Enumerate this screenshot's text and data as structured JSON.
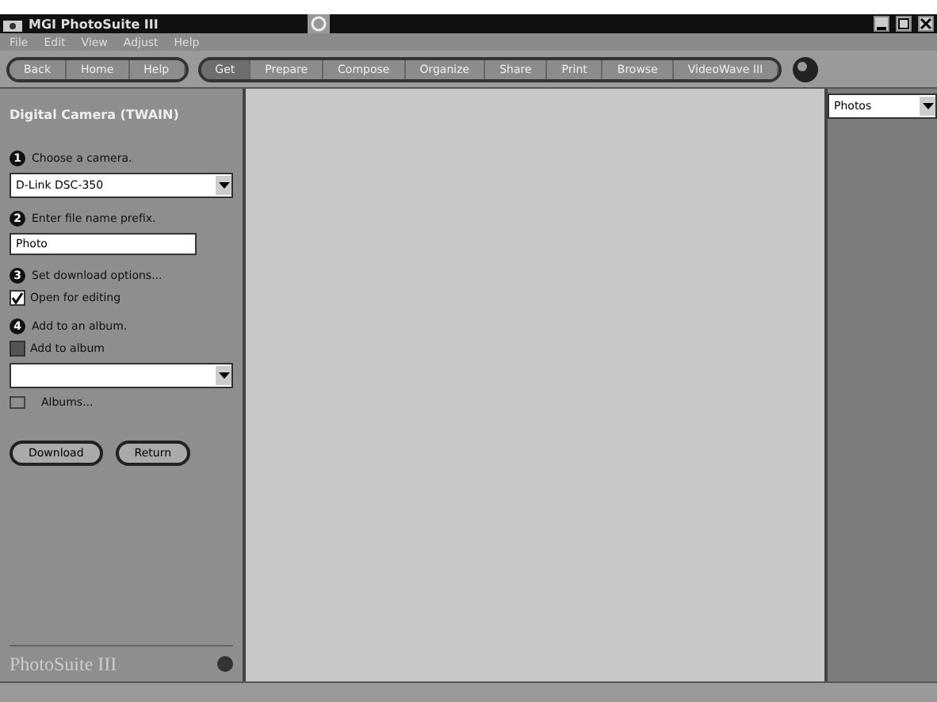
{
  "window": {
    "title": "MGI PhotoSuite III"
  },
  "menu": [
    "File",
    "Edit",
    "View",
    "Adjust",
    "Help"
  ],
  "nav_buttons": [
    "Back",
    "Home",
    "Help"
  ],
  "activity_tabs": [
    {
      "label": "Get",
      "selected": true
    },
    {
      "label": "Prepare",
      "selected": false
    },
    {
      "label": "Compose",
      "selected": false
    },
    {
      "label": "Organize",
      "selected": false
    },
    {
      "label": "Share",
      "selected": false
    },
    {
      "label": "Print",
      "selected": false
    },
    {
      "label": "Browse",
      "selected": false
    },
    {
      "label": "VideoWave III",
      "selected": false
    }
  ],
  "panel": {
    "title": "Digital Camera (TWAIN)",
    "steps": [
      {
        "number": "1",
        "label": "Choose a camera.",
        "kind": "dropdown",
        "value": "D-Link DSC-350"
      },
      {
        "number": "2",
        "label": "Enter file name prefix.",
        "kind": "input",
        "value": "Photo"
      },
      {
        "number": "3",
        "label": "Set download options...",
        "kind": "checkbox",
        "option": "Open for editing",
        "checked": true
      },
      {
        "number": "4",
        "label": "Add to an album.",
        "kind": "album",
        "option": "Add to album",
        "checked": false,
        "link": "Albums..."
      }
    ],
    "buttons": [
      "Download",
      "Return"
    ],
    "logo": "PhotoSuite III"
  },
  "right_panel": {
    "dropdown": "Photos"
  }
}
